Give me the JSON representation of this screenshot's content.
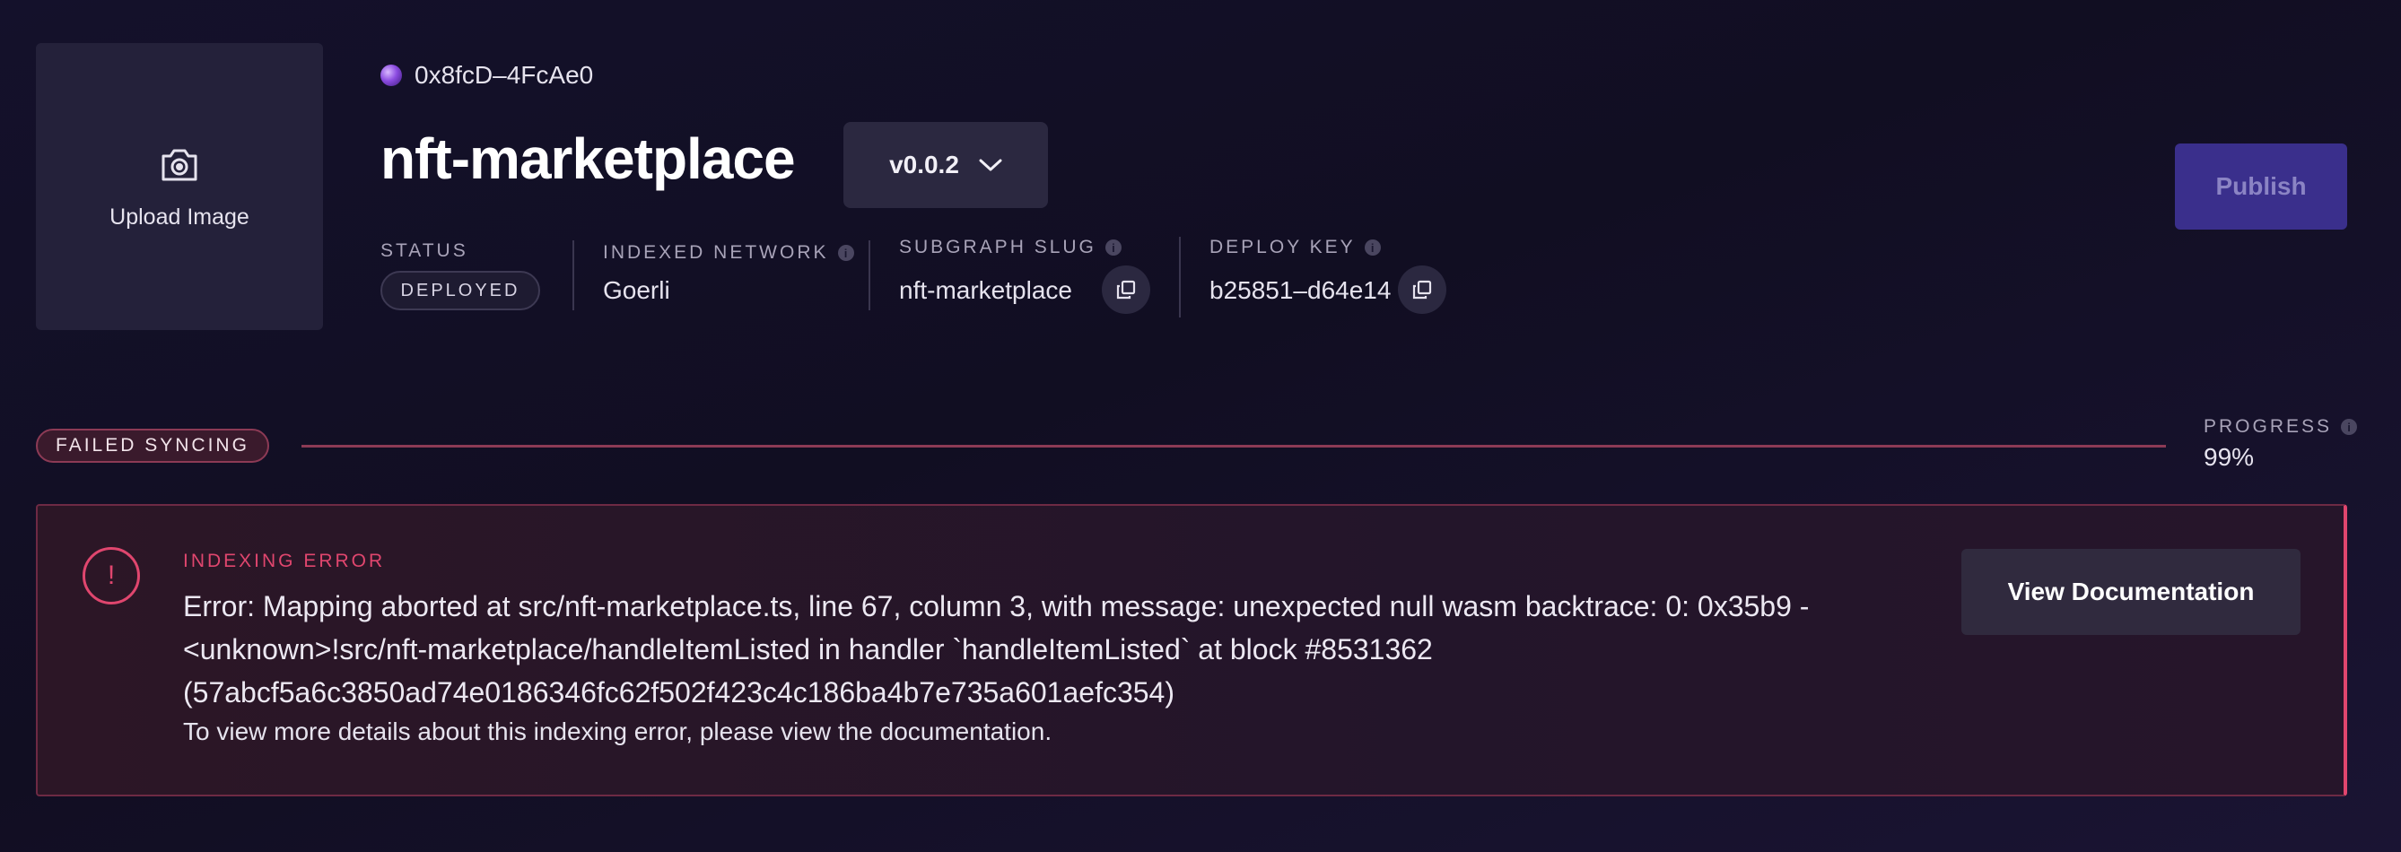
{
  "upload": {
    "label": "Upload Image"
  },
  "account": {
    "address": "0x8fcD–4FcAe0"
  },
  "subgraph": {
    "title": "nft-marketplace",
    "version": "v0.0.2",
    "publish_label": "Publish"
  },
  "meta": {
    "status": {
      "label": "STATUS",
      "value": "DEPLOYED"
    },
    "network": {
      "label": "INDEXED NETWORK",
      "value": "Goerli"
    },
    "slug": {
      "label": "SUBGRAPH SLUG",
      "value": "nft-marketplace"
    },
    "deploy_key": {
      "label": "DEPLOY KEY",
      "value": "b25851–d64e14"
    }
  },
  "sync": {
    "status": "FAILED SYNCING",
    "progress_label": "PROGRESS",
    "progress_value": "99%",
    "progress_fraction": 0.99,
    "line_color": "#8c3a55"
  },
  "error": {
    "title": "INDEXING ERROR",
    "message": "Error: Mapping aborted at src/nft-marketplace.ts, line 67, column 3, with message: unexpected null wasm backtrace: 0: 0x35b9 - <unknown>!src/nft-marketplace/handleItemListed in handler `handleItemListed` at block #8531362 (57abcf5a6c3850ad74e0186346fc62f502f423c4c186ba4b7e735a601aefc354)",
    "help": "To view more details about this indexing error, please view the documentation.",
    "button_label": "View Documentation",
    "accent_color": "#e0466e"
  },
  "icons": {
    "upload": "camera-icon",
    "avatar": "avatar-icon",
    "version_toggle": "chevron-down-icon",
    "copy": "copy-icon",
    "info": "info-icon",
    "error": "exclamation-icon"
  },
  "colors": {
    "background": "#13102a",
    "publish_button": "#3a2f8c",
    "error_accent": "#e0466e"
  }
}
